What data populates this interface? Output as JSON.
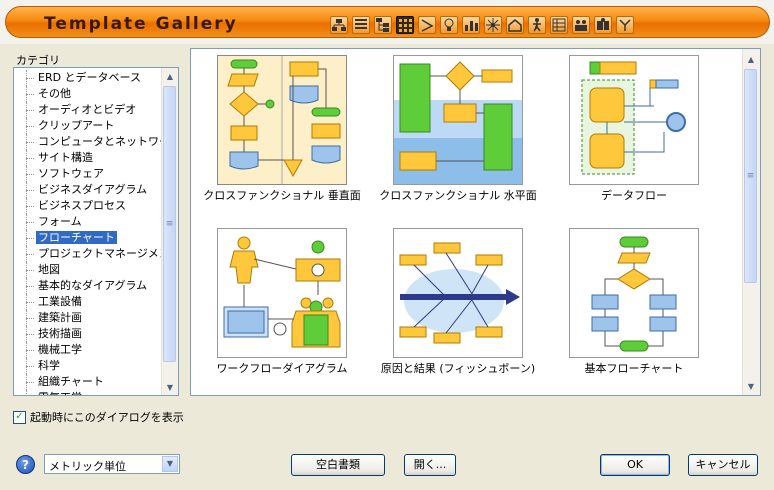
{
  "window": {
    "title": "Template Gallery",
    "toolbar_icons": [
      "hierarchy-icon",
      "list-icon",
      "tree-icon",
      "grid-icon",
      "connector-icon",
      "bulb-icon",
      "bar-chart-icon",
      "network-icon",
      "building-icon",
      "worker-icon",
      "table-icon",
      "people-icon",
      "puzzle-icon",
      "fork-icon"
    ],
    "selected_toolbar_icon": "grid-icon"
  },
  "categories": {
    "label": "カテゴリ",
    "items": [
      "ERD とデータベース",
      "その他",
      "オーディオとビデオ",
      "クリップアート",
      "コンピュータとネットワーク",
      "サイト構造",
      "ソフトウェア",
      "ビジネスダイアグラム",
      "ビジネスプロセス",
      "フォーム",
      "フローチャート",
      "プロジェクトマネージメント",
      "地図",
      "基本的なダイアグラム",
      "工業設備",
      "建築計画",
      "技術描画",
      "機械工学",
      "科学",
      "組織チャート",
      "電気工学"
    ],
    "selected": "フローチャート"
  },
  "templates": [
    {
      "name": "クロスファンクショナル 垂直面",
      "selected": true
    },
    {
      "name": "クロスファンクショナル 水平面",
      "selected": false
    },
    {
      "name": "データフロー",
      "selected": false
    },
    {
      "name": "ワークフローダイアグラム",
      "selected": false
    },
    {
      "name": "原因と結果 (フィッシュボーン)",
      "selected": false
    },
    {
      "name": "基本フローチャート",
      "selected": false
    }
  ],
  "startup_checkbox": {
    "label": "起動時にこのダイアログを表示",
    "checked": true
  },
  "units": {
    "selected": "メトリック単位"
  },
  "buttons": {
    "blank": "空白書類",
    "open": "開く...",
    "ok": "OK",
    "cancel": "キャンセル"
  },
  "help_label": "?",
  "colors": {
    "title_orange": "#f78a12",
    "selection_blue": "#316ac5",
    "shape_yellow": "#ffc83c",
    "shape_green": "#5fcc3a",
    "shape_blue": "#9ec4ec"
  }
}
